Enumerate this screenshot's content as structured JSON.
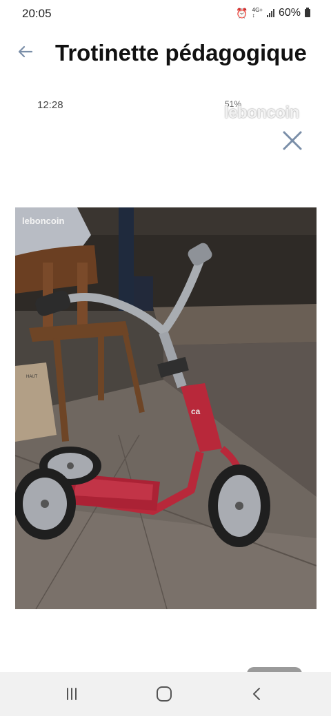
{
  "status_bar": {
    "time": "20:05",
    "battery": "60%"
  },
  "header": {
    "title": "Trotinette pédagogique"
  },
  "photo_overlay": {
    "time": "12:28",
    "status": "51%",
    "watermark": "leboncoin"
  },
  "photo": {
    "logo": "leboncoin"
  },
  "colors": {
    "scooter_red": "#b8283a",
    "accent_blue": "#7a8ea8"
  },
  "icons": {
    "back": "arrow-left-icon",
    "close": "close-icon",
    "recents": "recents-icon",
    "home": "home-icon",
    "nav_back": "chevron-left-icon"
  }
}
